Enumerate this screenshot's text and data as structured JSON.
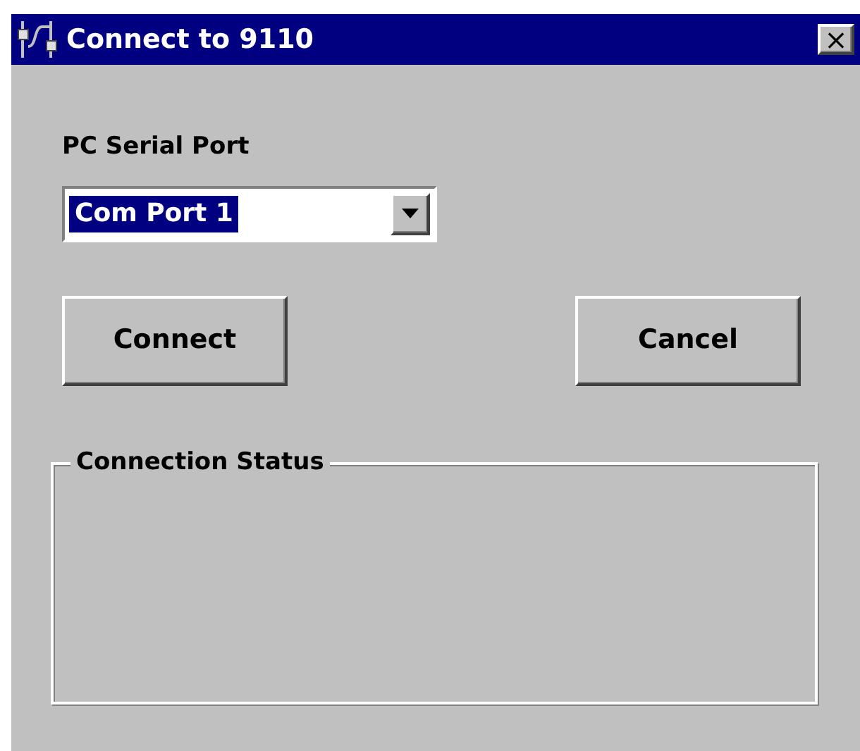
{
  "window": {
    "title": "Connect to 9110",
    "close_label": "×"
  },
  "port": {
    "label": "PC Serial Port",
    "value": "Com Port 1",
    "highlighted": true
  },
  "buttons": [
    {
      "label": "Connect"
    },
    {
      "label": "Cancel"
    }
  ],
  "status_group": {
    "title": "Connection Status"
  }
}
